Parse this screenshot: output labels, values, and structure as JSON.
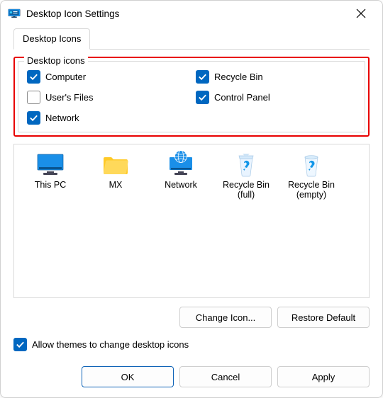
{
  "title": "Desktop Icon Settings",
  "tab_label": "Desktop Icons",
  "group_label": "Desktop icons",
  "checks": {
    "computer": {
      "label": "Computer",
      "checked": true
    },
    "recycle": {
      "label": "Recycle Bin",
      "checked": true
    },
    "user_files": {
      "label": "User's Files",
      "checked": false
    },
    "control_panel": {
      "label": "Control Panel",
      "checked": true
    },
    "network": {
      "label": "Network",
      "checked": true
    }
  },
  "icons": {
    "this_pc": {
      "label": "This PC"
    },
    "mx": {
      "label": "MX"
    },
    "network": {
      "label": "Network"
    },
    "bin_full": {
      "label": "Recycle Bin (full)"
    },
    "bin_empty": {
      "label": "Recycle Bin (empty)"
    }
  },
  "buttons": {
    "change_icon": "Change Icon...",
    "restore_default": "Restore Default",
    "ok": "OK",
    "cancel": "Cancel",
    "apply": "Apply"
  },
  "themes_checkbox": {
    "label": "Allow themes to change desktop icons",
    "checked": true
  },
  "colors": {
    "accent": "#0067c0",
    "highlight": "#e80000"
  }
}
